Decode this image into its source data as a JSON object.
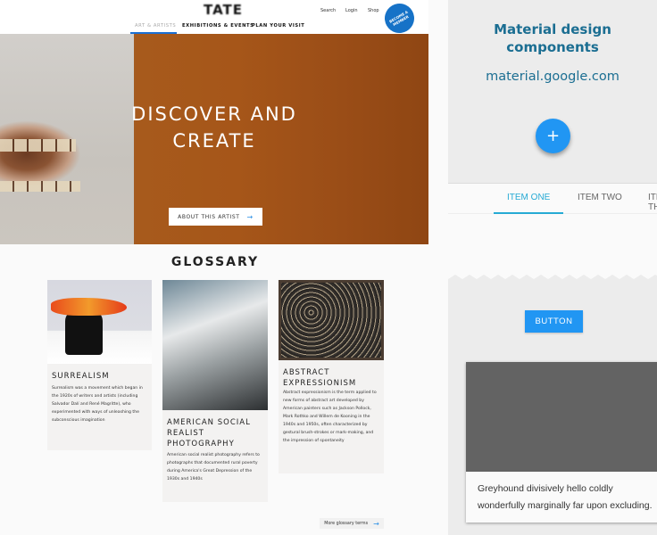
{
  "tate": {
    "logo": "TATE",
    "utility_links": [
      "Search",
      "Login",
      "Shop"
    ],
    "member_badge": "BECOME A MEMBER",
    "nav": [
      {
        "label": "ART & ARTISTS",
        "active": true
      },
      {
        "label": "EXHIBITIONS & EVENTS",
        "active": false
      },
      {
        "label": "PLAN YOUR VISIT",
        "active": false
      }
    ],
    "hero": {
      "title_line1": "DISCOVER AND",
      "title_line2": "CREATE",
      "button_label": "ABOUT THIS ARTIST",
      "button_icon": "arrow-right-icon"
    },
    "glossary": {
      "title": "GLOSSARY",
      "cards": [
        {
          "title": "SURREALISM",
          "body": "Surrealism was a movement which began in the 1920s of writers and artists (including Salvador Dalí and René Magritte), who experimented with ways of unleashing the subconscious imagination"
        },
        {
          "title": "AMERICAN SOCIAL REALIST PHOTOGRAPHY",
          "body": "American social realist photography refers to photographs that documented rural poverty during America's Great Depression of the 1930s and 1940s"
        },
        {
          "title": "ABSTRACT EXPRESSIONISM",
          "body": "Abstract expressionism is the term applied to new forms of abstract art developed by American painters such as Jackson Pollock, Mark Rothko and Willem de Kooning in the 1940s and 1950s, often characterized by gestural brush-strokes or mark-making, and the impression of spontaneity"
        }
      ],
      "more_label": "More glossary terms",
      "more_icon": "arrow-right-icon"
    }
  },
  "material": {
    "title_line1": "Material design",
    "title_line2": "components",
    "url": "material.google.com",
    "fab_icon": "+",
    "tabs": [
      {
        "label": "ITEM ONE",
        "active": true
      },
      {
        "label": "ITEM TWO",
        "active": false
      },
      {
        "label": "ITEM THREE",
        "active": false
      }
    ],
    "button_label": "BUTTON",
    "card_text": "Greyhound divisively hello coldly wonderfully marginally far upon excluding.",
    "colors": {
      "primary": "#2196f3",
      "tab_accent": "#26aad4",
      "title": "#1b6e92"
    }
  }
}
